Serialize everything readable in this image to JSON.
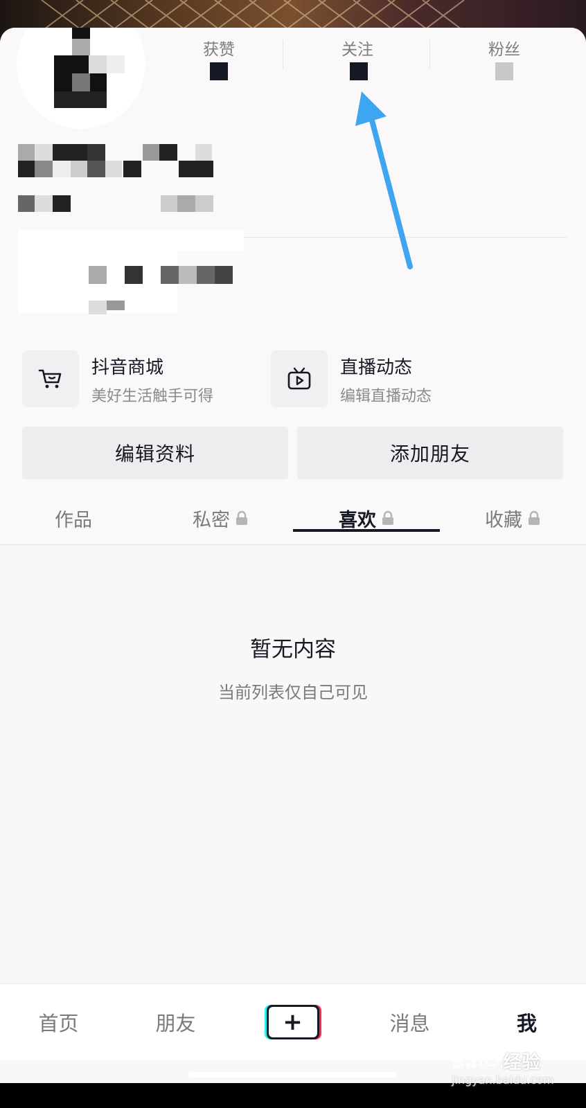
{
  "stats": [
    {
      "label": "获赞"
    },
    {
      "label": "关注"
    },
    {
      "label": "粉丝"
    }
  ],
  "shortcuts": [
    {
      "title": "抖音商城",
      "subtitle": "美好生活触手可得",
      "icon": "shopping-cart-icon"
    },
    {
      "title": "直播动态",
      "subtitle": "编辑直播动态",
      "icon": "tv-play-icon"
    }
  ],
  "buttons": {
    "edit_profile": "编辑资料",
    "add_friend": "添加朋友"
  },
  "tabs": [
    {
      "label": "作品",
      "locked": false
    },
    {
      "label": "私密",
      "locked": true
    },
    {
      "label": "喜欢",
      "locked": true,
      "active": true
    },
    {
      "label": "收藏",
      "locked": true
    }
  ],
  "empty_state": {
    "title": "暂无内容",
    "subtitle": "当前列表仅自己可见"
  },
  "bottom_nav": {
    "home": "首页",
    "friends": "朋友",
    "messages": "消息",
    "me": "我"
  },
  "watermark": {
    "text": "经验",
    "url": "jingyan.baidu.com"
  },
  "colors": {
    "text": "#161823",
    "muted": "#7a7a7e",
    "annotation_arrow": "#3ea6f0",
    "tiktok_cyan": "#25f4ee",
    "tiktok_red": "#fe2c55"
  }
}
